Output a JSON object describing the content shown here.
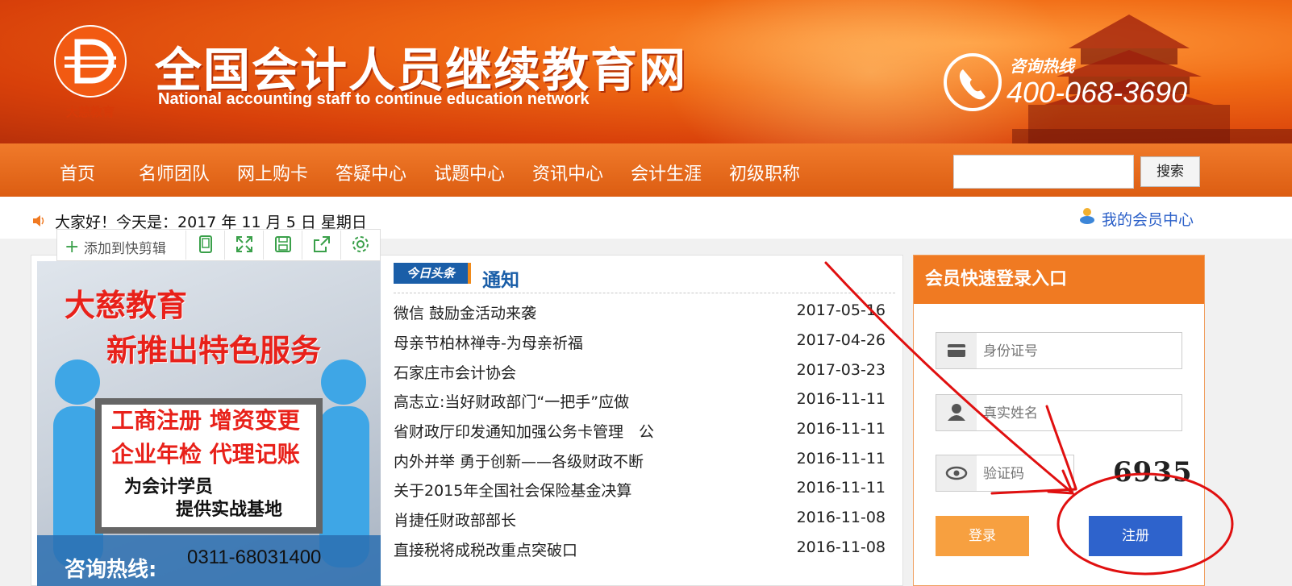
{
  "header": {
    "logo_text": "大慈教育",
    "site_title": "全国会计人员继续教育网",
    "site_subtitle": "National accounting staff to continue education network",
    "hotline_label": "咨询热线",
    "hotline_number": "400-068-3690"
  },
  "nav": {
    "items": [
      "首页",
      "名师团队",
      "网上购卡",
      "答疑中心",
      "试题中心",
      "资讯中心",
      "会计生涯",
      "初级职称"
    ],
    "search_button": "搜索",
    "search_value": ""
  },
  "greeting_bar": {
    "greeting": "大家好！今天是：2017 年 11 月 5 日 星期日",
    "member_center": "我的会员中心"
  },
  "clip_toolbar": {
    "add_label": "添加到快剪辑",
    "icons": [
      "phone-frame-icon",
      "expand-icon",
      "save-icon",
      "share-icon",
      "settings-icon"
    ]
  },
  "promo": {
    "brand": "大慈教育",
    "slogan": "新推出特色服务",
    "line1": "工商注册  增资变更",
    "line2": "企业年检  代理记账",
    "line3": "为会计学员",
    "line4": "提供实战基地",
    "consult": "咨询热线:",
    "phone": "0311-68031400"
  },
  "news": {
    "badge": "今日头条",
    "title": "通知",
    "items": [
      {
        "title": "微信 鼓励金活动来袭",
        "date": "2017-05-16"
      },
      {
        "title": "母亲节柏林禅寺-为母亲祈福",
        "date": "2017-04-26"
      },
      {
        "title": "石家庄市会计协会",
        "date": "2017-03-23"
      },
      {
        "title": "高志立:当好财政部门“一把手”应做",
        "date": "2016-11-11"
      },
      {
        "title": "省财政厅印发通知加强公务卡管理　公",
        "date": "2016-11-11"
      },
      {
        "title": "内外并举 勇于创新——各级财政不断",
        "date": "2016-11-11"
      },
      {
        "title": "关于2015年全国社会保险基金决算",
        "date": "2016-11-11"
      },
      {
        "title": "肖捷任财政部部长",
        "date": "2016-11-08"
      },
      {
        "title": "直接税将成税改重点突破口",
        "date": "2016-11-08"
      }
    ]
  },
  "login": {
    "header": "会员快速登录入口",
    "id_placeholder": "身份证号",
    "name_placeholder": "真实姓名",
    "captcha_placeholder": "验证码",
    "captcha_code": "6935",
    "login_button": "登录",
    "register_button": "注册"
  },
  "colors": {
    "brand_orange": "#f07a22",
    "link_blue": "#2a5fc8",
    "register_blue": "#2e63cc",
    "annotation_red": "#e01010"
  }
}
